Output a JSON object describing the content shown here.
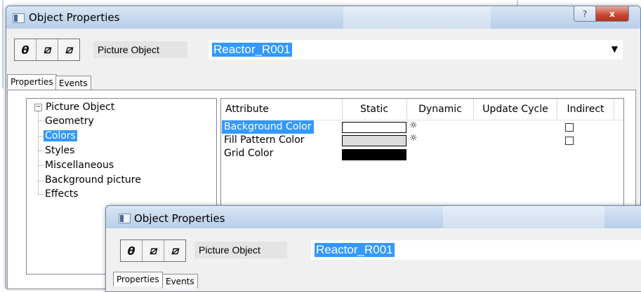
{
  "colors": {
    "selection": "#3399ff",
    "title_gradient_top": "#d9e7f6",
    "title_gradient_bottom": "#b9cfe8",
    "close_red": "#c7462f",
    "window_bg": "#f0f0f0"
  },
  "main_window": {
    "title": "Object Properties",
    "help_glyph": "?",
    "close_glyph": "x",
    "toolbar_icons": [
      "lock-icon",
      "wand-icon",
      "wand-alt-icon"
    ],
    "toolbar_glyphs": [
      "θ",
      "⧄",
      "⧄"
    ],
    "object_type": "Picture Object",
    "object_name": "Reactor_R001",
    "dropdown_glyph": "▼",
    "tabs": [
      {
        "label": "Properties"
      },
      {
        "label": "Events"
      }
    ],
    "tree": {
      "expander": "−",
      "items": [
        {
          "label": "Picture Object"
        },
        {
          "label": "Geometry"
        },
        {
          "label": "Colors"
        },
        {
          "label": "Styles"
        },
        {
          "label": "Miscellaneous"
        },
        {
          "label": "Background picture"
        },
        {
          "label": "Effects"
        }
      ]
    },
    "grid": {
      "columns": [
        "Attribute",
        "Static",
        "Dynamic",
        "Update Cycle",
        "Indirect"
      ],
      "rows": [
        {
          "attribute": "Background Color",
          "color": "#ffffff",
          "has_dynamic": true,
          "indirect": "☐"
        },
        {
          "attribute": "Fill Pattern Color",
          "color": "#dcdcdc",
          "has_dynamic": true,
          "indirect": "☐"
        },
        {
          "attribute": "Grid Color",
          "color": "#000000",
          "has_dynamic": false,
          "indirect": ""
        }
      ],
      "bulb_glyph": "☼"
    }
  },
  "secondary_window": {
    "title": "Object Properties",
    "object_type": "Picture Object",
    "object_name": "Reactor_R001",
    "tabs": [
      {
        "label": "Properties"
      },
      {
        "label": "Events"
      }
    ]
  }
}
